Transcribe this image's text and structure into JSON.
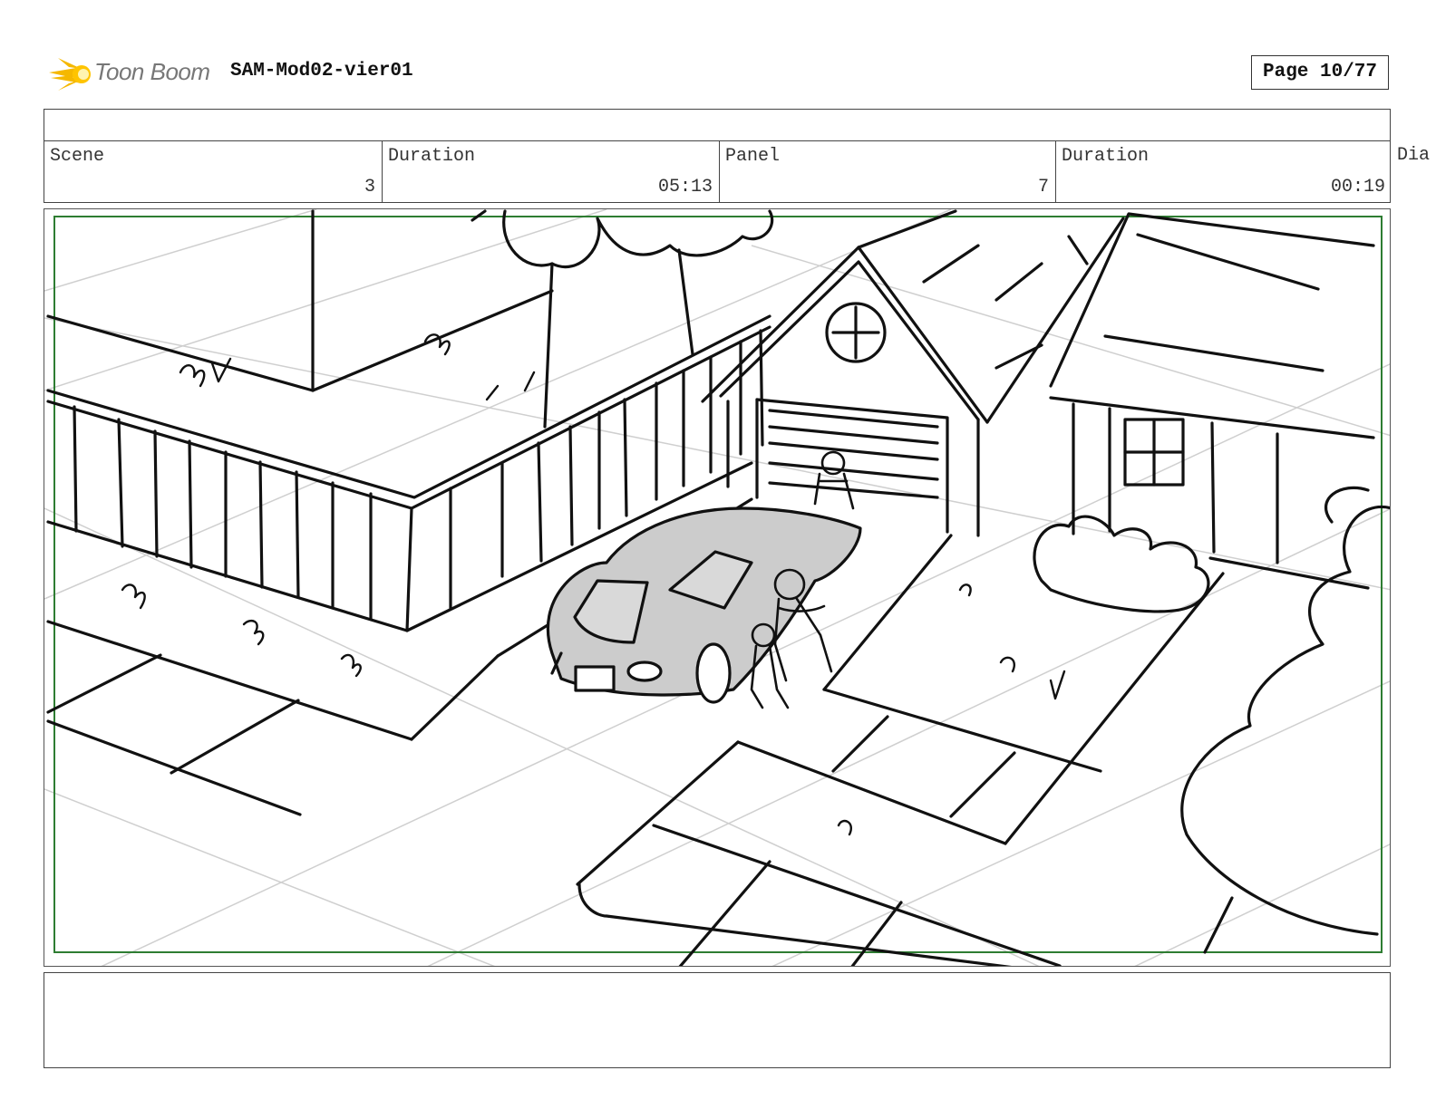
{
  "header": {
    "logo_text": "Toon Boom",
    "project_name": "SAM-Mod02-vier01",
    "page_indicator": "Page 10/77"
  },
  "title_strip": "",
  "info_row": [
    {
      "label": "Scene",
      "value": "3"
    },
    {
      "label": "Duration",
      "value": "05:13"
    },
    {
      "label": "Panel",
      "value": "7"
    },
    {
      "label": "Duration",
      "value": "00:19"
    }
  ],
  "overflow_label": "Dia",
  "notes": "",
  "colors": {
    "safe_frame": "#2e7d32",
    "logo_flame": "#f5b800",
    "car_fill": "#cccccc",
    "guide_lines": "#cfcfcf"
  }
}
